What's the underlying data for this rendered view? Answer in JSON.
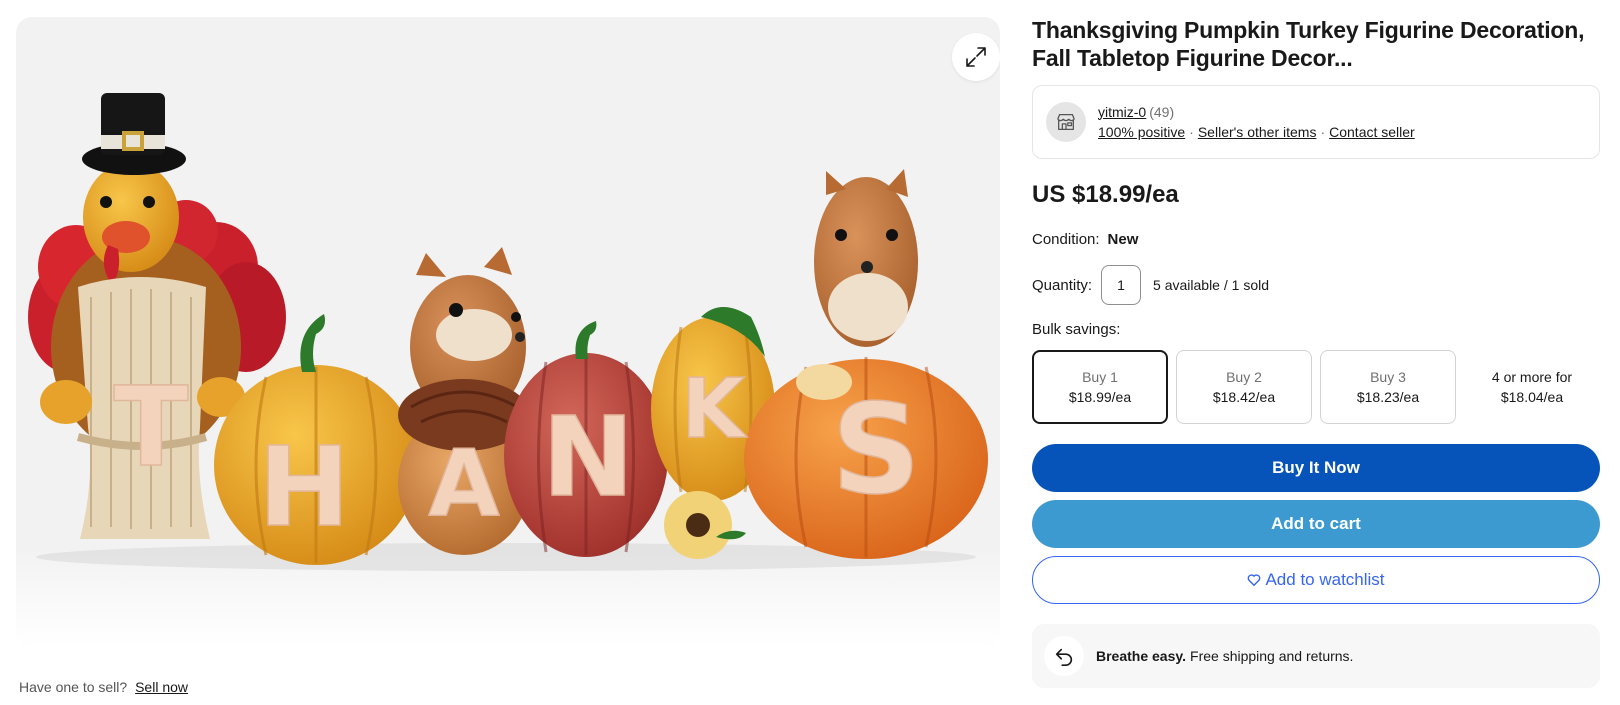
{
  "gallery": {
    "expand_icon": "expand-arrows-icon",
    "letters": [
      "T",
      "H",
      "A",
      "N",
      "K",
      "S"
    ]
  },
  "sell": {
    "prompt": "Have one to sell?",
    "link": "Sell now"
  },
  "listing": {
    "title": "Thanksgiving Pumpkin Turkey Figurine Decoration, Fall Tabletop Figurine Decor..."
  },
  "seller": {
    "avatar_icon": "store-icon",
    "name": "yitmiz-0",
    "feedback_count": "(49)",
    "positive": "100% positive",
    "other_items": "Seller's other items",
    "contact": "Contact seller"
  },
  "price": {
    "text": "US $18.99/ea"
  },
  "condition": {
    "label": "Condition:",
    "value": "New"
  },
  "quantity": {
    "label": "Quantity:",
    "value": "1",
    "availability": "5 available / 1 sold"
  },
  "bulk": {
    "label": "Bulk savings:",
    "options": [
      {
        "label": "Buy 1",
        "price": "$18.99/ea"
      },
      {
        "label": "Buy 2",
        "price": "$18.42/ea"
      },
      {
        "label": "Buy 3",
        "price": "$18.23/ea"
      },
      {
        "label": "4 or more for",
        "price": "$18.04/ea"
      }
    ]
  },
  "actions": {
    "buy_now": "Buy It Now",
    "add_to_cart": "Add to cart",
    "watchlist": "Add to watchlist"
  },
  "returns": {
    "icon": "return-arrow-icon",
    "bold": "Breathe easy.",
    "text": "Free shipping and returns."
  },
  "colors": {
    "buy_now": "#0654ba",
    "add_to_cart": "#3d9ad1",
    "watchlist": "#3665f3"
  }
}
